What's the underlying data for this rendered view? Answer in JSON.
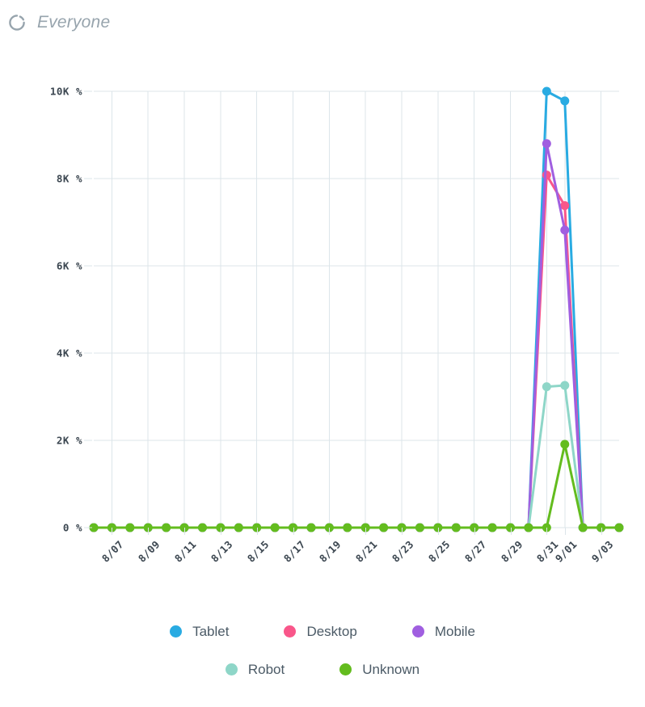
{
  "header": {
    "icon": "loading-spinner-icon",
    "title": "Everyone"
  },
  "chart_data": {
    "type": "line",
    "title": "",
    "subtitle": "",
    "xlabel": "",
    "ylabel": "",
    "grid": true,
    "legend_position": "bottom",
    "ylim": [
      0,
      10000
    ],
    "y_ticks": [
      0,
      2000,
      4000,
      6000,
      8000,
      10000
    ],
    "y_tick_labels": [
      "0 %",
      "2K %",
      "4K %",
      "6K %",
      "8K %",
      "10K %"
    ],
    "x": [
      "8/06",
      "8/07",
      "8/08",
      "8/09",
      "8/10",
      "8/11",
      "8/12",
      "8/13",
      "8/14",
      "8/15",
      "8/16",
      "8/17",
      "8/18",
      "8/19",
      "8/20",
      "8/21",
      "8/22",
      "8/23",
      "8/24",
      "8/25",
      "8/26",
      "8/27",
      "8/28",
      "8/29",
      "8/30",
      "8/31",
      "9/01",
      "9/02",
      "9/03",
      "9/04"
    ],
    "x_tick_labels": [
      "8/07",
      "8/09",
      "8/11",
      "8/13",
      "8/15",
      "8/17",
      "8/19",
      "8/21",
      "8/23",
      "8/25",
      "8/27",
      "8/29",
      "8/31",
      "9/01",
      "9/03"
    ],
    "x_tick_indices": [
      1,
      3,
      5,
      7,
      9,
      11,
      13,
      15,
      17,
      19,
      21,
      23,
      25,
      26,
      28
    ],
    "series": [
      {
        "name": "Tablet",
        "color": "#29abe2",
        "values": [
          0,
          0,
          0,
          0,
          0,
          0,
          0,
          0,
          0,
          0,
          0,
          0,
          0,
          0,
          0,
          0,
          0,
          0,
          0,
          0,
          0,
          0,
          0,
          0,
          0,
          10000,
          9780,
          0,
          0,
          0
        ]
      },
      {
        "name": "Desktop",
        "color": "#f9568a",
        "values": [
          0,
          0,
          0,
          0,
          0,
          0,
          0,
          0,
          0,
          0,
          0,
          0,
          0,
          0,
          0,
          0,
          0,
          0,
          0,
          0,
          0,
          0,
          0,
          0,
          0,
          8080,
          7380,
          0,
          0,
          0
        ]
      },
      {
        "name": "Mobile",
        "color": "#a05fe0",
        "values": [
          0,
          0,
          0,
          0,
          0,
          0,
          0,
          0,
          0,
          0,
          0,
          0,
          0,
          0,
          0,
          0,
          0,
          0,
          0,
          0,
          0,
          0,
          0,
          0,
          0,
          8800,
          6820,
          0,
          0,
          0
        ]
      },
      {
        "name": "Robot",
        "color": "#8ed6c8",
        "values": [
          0,
          0,
          0,
          0,
          0,
          0,
          0,
          0,
          0,
          0,
          0,
          0,
          0,
          0,
          0,
          0,
          0,
          0,
          0,
          0,
          0,
          0,
          0,
          0,
          0,
          3230,
          3260,
          0,
          0,
          0
        ]
      },
      {
        "name": "Unknown",
        "color": "#63bc1e",
        "values": [
          0,
          0,
          0,
          0,
          0,
          0,
          0,
          0,
          0,
          0,
          0,
          0,
          0,
          0,
          0,
          0,
          0,
          0,
          0,
          0,
          0,
          0,
          0,
          0,
          0,
          0,
          1910,
          0,
          0,
          0
        ]
      }
    ]
  },
  "legend": {
    "rows": [
      [
        {
          "label": "Tablet",
          "color": "#29abe2"
        },
        {
          "label": "Desktop",
          "color": "#f9568a"
        },
        {
          "label": "Mobile",
          "color": "#a05fe0"
        }
      ],
      [
        {
          "label": "Robot",
          "color": "#8ed6c8"
        },
        {
          "label": "Unknown",
          "color": "#63bc1e"
        }
      ]
    ]
  },
  "style": {
    "grid_color": "#dce5ea",
    "axis_text_color": "#3b4650",
    "legend_text_color": "#4b5a66",
    "header_text_color": "#97a4ad",
    "background": "#ffffff"
  }
}
